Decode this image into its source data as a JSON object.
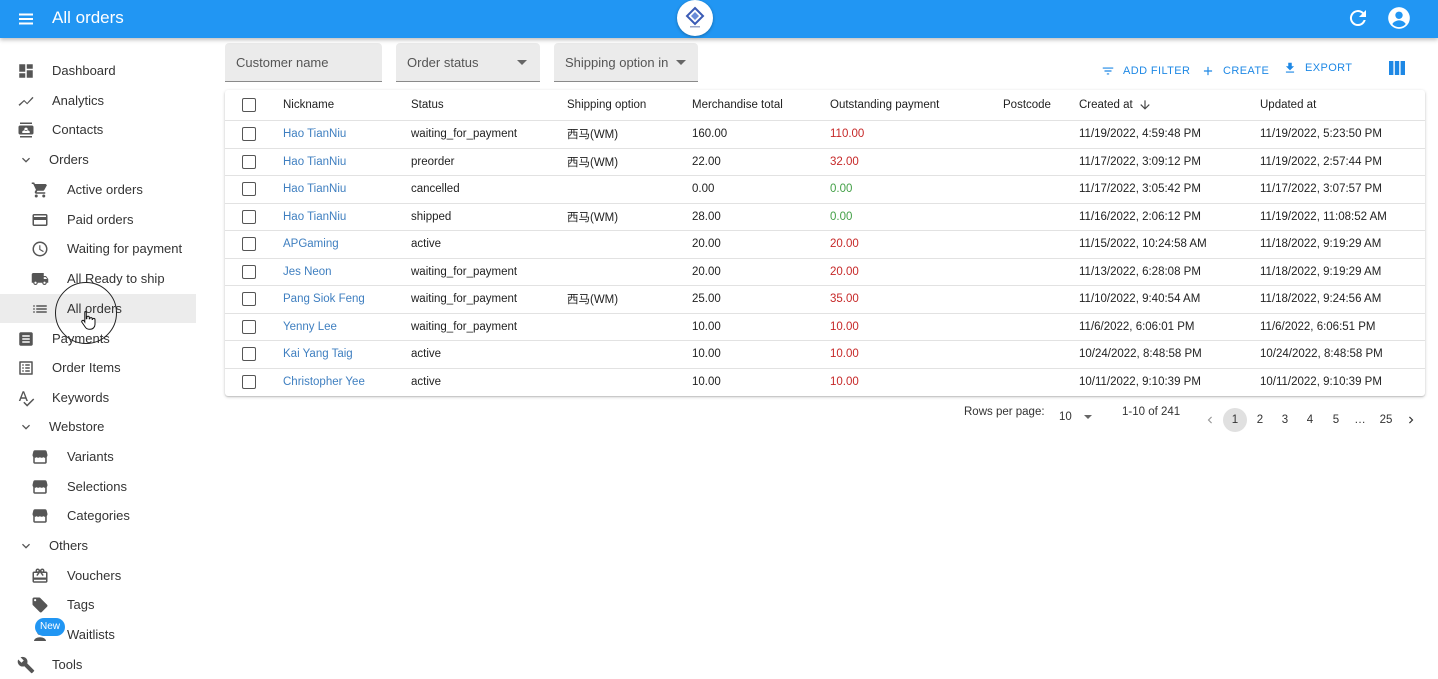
{
  "appbar": {
    "title": "All orders"
  },
  "sidebar": {
    "items": [
      {
        "label": "Dashboard",
        "icon": "dashboard-icon"
      },
      {
        "label": "Analytics",
        "icon": "analytics-icon"
      },
      {
        "label": "Contacts",
        "icon": "contacts-icon"
      },
      {
        "label": "Orders",
        "icon": "chevron-down-icon"
      },
      {
        "label": "Active orders",
        "icon": "cart-icon"
      },
      {
        "label": "Paid orders",
        "icon": "credit-card-icon"
      },
      {
        "label": "Waiting for payment",
        "icon": "clock-icon"
      },
      {
        "label": "All Ready to ship",
        "icon": "truck-icon"
      },
      {
        "label": "All orders",
        "icon": "list-icon"
      },
      {
        "label": "Payments",
        "icon": "receipt-icon"
      },
      {
        "label": "Order Items",
        "icon": "list-alt-icon"
      },
      {
        "label": "Keywords",
        "icon": "spellcheck-icon"
      },
      {
        "label": "Webstore",
        "icon": "chevron-down-icon"
      },
      {
        "label": "Variants",
        "icon": "store-icon"
      },
      {
        "label": "Selections",
        "icon": "store-icon"
      },
      {
        "label": "Categories",
        "icon": "store-icon"
      },
      {
        "label": "Others",
        "icon": "chevron-down-icon"
      },
      {
        "label": "Vouchers",
        "icon": "gift-card-icon"
      },
      {
        "label": "Tags",
        "icon": "tag-icon"
      },
      {
        "label": "Waitlists",
        "icon": "person-icon"
      },
      {
        "label": "Tools",
        "icon": "wrench-icon"
      }
    ],
    "new_badge": "New"
  },
  "filters": {
    "customer_name": "Customer name",
    "order_status": "Order status",
    "shipping_option": "Shipping option in"
  },
  "toolbar": {
    "add_filter": "ADD FILTER",
    "create": "CREATE",
    "export": "EXPORT"
  },
  "table": {
    "headers": [
      "Nickname",
      "Status",
      "Shipping option",
      "Merchandise total",
      "Outstanding payment",
      "Postcode",
      "Created at",
      "Updated at"
    ],
    "rows": [
      {
        "nickname": "Hao TianNiu",
        "status": "waiting_for_payment",
        "shipping": "西马(WM)",
        "total": "160.00",
        "outstanding": "110.00",
        "postcode": "",
        "created": "11/19/2022, 4:59:48 PM",
        "updated": "11/19/2022, 5:23:50 PM"
      },
      {
        "nickname": "Hao TianNiu",
        "status": "preorder",
        "shipping": "西马(WM)",
        "total": "22.00",
        "outstanding": "32.00",
        "postcode": "",
        "created": "11/17/2022, 3:09:12 PM",
        "updated": "11/19/2022, 2:57:44 PM"
      },
      {
        "nickname": "Hao TianNiu",
        "status": "cancelled",
        "shipping": "",
        "total": "0.00",
        "outstanding": "0.00",
        "postcode": "",
        "created": "11/17/2022, 3:05:42 PM",
        "updated": "11/17/2022, 3:07:57 PM"
      },
      {
        "nickname": "Hao TianNiu",
        "status": "shipped",
        "shipping": "西马(WM)",
        "total": "28.00",
        "outstanding": "0.00",
        "postcode": "",
        "created": "11/16/2022, 2:06:12 PM",
        "updated": "11/19/2022, 11:08:52 AM"
      },
      {
        "nickname": "APGaming",
        "status": "active",
        "shipping": "",
        "total": "20.00",
        "outstanding": "20.00",
        "postcode": "",
        "created": "11/15/2022, 10:24:58 AM",
        "updated": "11/18/2022, 9:19:29 AM"
      },
      {
        "nickname": "Jes Neon",
        "status": "waiting_for_payment",
        "shipping": "",
        "total": "20.00",
        "outstanding": "20.00",
        "postcode": "",
        "created": "11/13/2022, 6:28:08 PM",
        "updated": "11/18/2022, 9:19:29 AM"
      },
      {
        "nickname": "Pang Siok Feng",
        "status": "waiting_for_payment",
        "shipping": "西马(WM)",
        "total": "25.00",
        "outstanding": "35.00",
        "postcode": "",
        "created": "11/10/2022, 9:40:54 AM",
        "updated": "11/18/2022, 9:24:56 AM"
      },
      {
        "nickname": "Yenny Lee",
        "status": "waiting_for_payment",
        "shipping": "",
        "total": "10.00",
        "outstanding": "10.00",
        "postcode": "",
        "created": "11/6/2022, 6:06:01 PM",
        "updated": "11/6/2022, 6:06:51 PM"
      },
      {
        "nickname": "Kai Yang Taig",
        "status": "active",
        "shipping": "",
        "total": "10.00",
        "outstanding": "10.00",
        "postcode": "",
        "created": "10/24/2022, 8:48:58 PM",
        "updated": "10/24/2022, 8:48:58 PM"
      },
      {
        "nickname": "Christopher Yee",
        "status": "active",
        "shipping": "",
        "total": "10.00",
        "outstanding": "10.00",
        "postcode": "",
        "created": "10/11/2022, 9:10:39 PM",
        "updated": "10/11/2022, 9:10:39 PM"
      }
    ]
  },
  "pagination": {
    "rows_per_page_label": "Rows per page:",
    "rows_per_page": "10",
    "range": "1-10 of 241",
    "pages": [
      "1",
      "2",
      "3",
      "4",
      "5",
      "…",
      "25"
    ],
    "current": "1"
  },
  "colors": {
    "appbar": "#2196f3",
    "link": "#3f7fc0",
    "outstanding_due": "#c62828",
    "outstanding_paid": "#43a047"
  }
}
